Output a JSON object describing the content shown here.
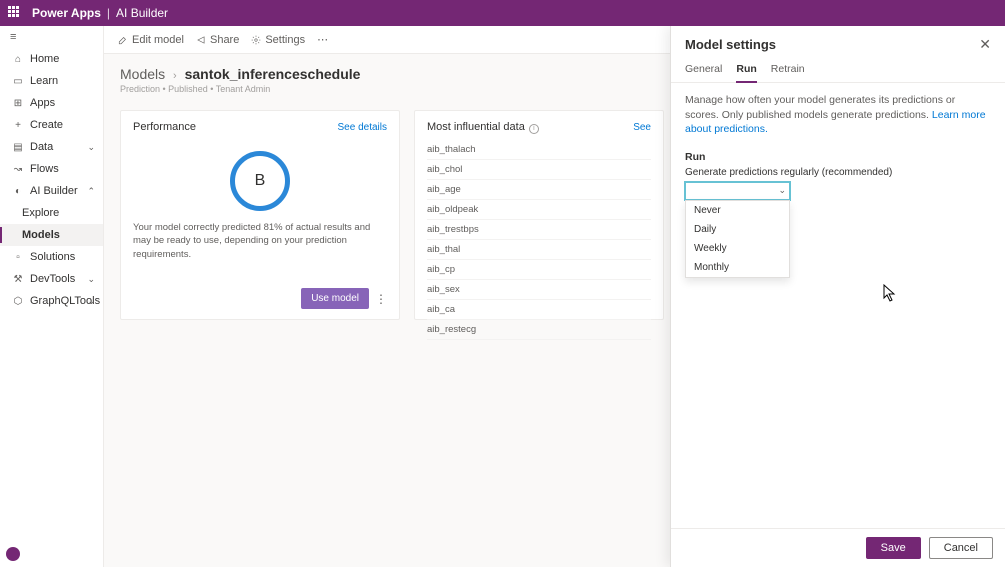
{
  "topbar": {
    "app": "Power Apps",
    "module": "AI Builder"
  },
  "leftnav": {
    "items": [
      {
        "icon": "⌂",
        "label": "Home"
      },
      {
        "icon": "▭",
        "label": "Learn"
      },
      {
        "icon": "⊞",
        "label": "Apps"
      },
      {
        "icon": "+",
        "label": "Create"
      },
      {
        "icon": "▤",
        "label": "Data",
        "chev": true
      },
      {
        "icon": "↝",
        "label": "Flows"
      },
      {
        "icon": "◐",
        "label": "AI Builder",
        "chev": true,
        "expanded": true
      },
      {
        "icon": "▫",
        "label": "Solutions"
      },
      {
        "icon": "⚒",
        "label": "DevTools",
        "chev": true
      },
      {
        "icon": "⬡",
        "label": "GraphQLTools",
        "chev": true
      }
    ],
    "sub": {
      "explore": "Explore",
      "models": "Models"
    }
  },
  "commands": {
    "edit": "Edit model",
    "share": "Share",
    "settings": "Settings"
  },
  "breadcrumb": {
    "root": "Models",
    "current": "santok_inferenceschedule",
    "sub": "Prediction • Published • Tenant Admin"
  },
  "perf": {
    "title": "Performance",
    "link": "See details",
    "grade": "B",
    "text": "Your model correctly predicted 81% of actual results and may be ready to use, depending on your prediction requirements.",
    "useBtn": "Use model"
  },
  "influential": {
    "title": "Most influential data",
    "link": "See",
    "rows": [
      "aib_thalach",
      "aib_chol",
      "aib_age",
      "aib_oldpeak",
      "aib_trestbps",
      "aib_thal",
      "aib_cp",
      "aib_sex",
      "aib_ca",
      "aib_restecg"
    ]
  },
  "panel": {
    "title": "Model settings",
    "tabs": {
      "general": "General",
      "run": "Run",
      "retrain": "Retrain"
    },
    "desc": "Manage how often your model generates its predictions or scores. Only published models generate predictions. ",
    "descLink": "Learn more about predictions.",
    "runHeader": "Run",
    "fieldLabel": "Generate predictions regularly (recommended)",
    "options": [
      "Never",
      "Daily",
      "Weekly",
      "Monthly"
    ],
    "save": "Save",
    "cancel": "Cancel"
  }
}
